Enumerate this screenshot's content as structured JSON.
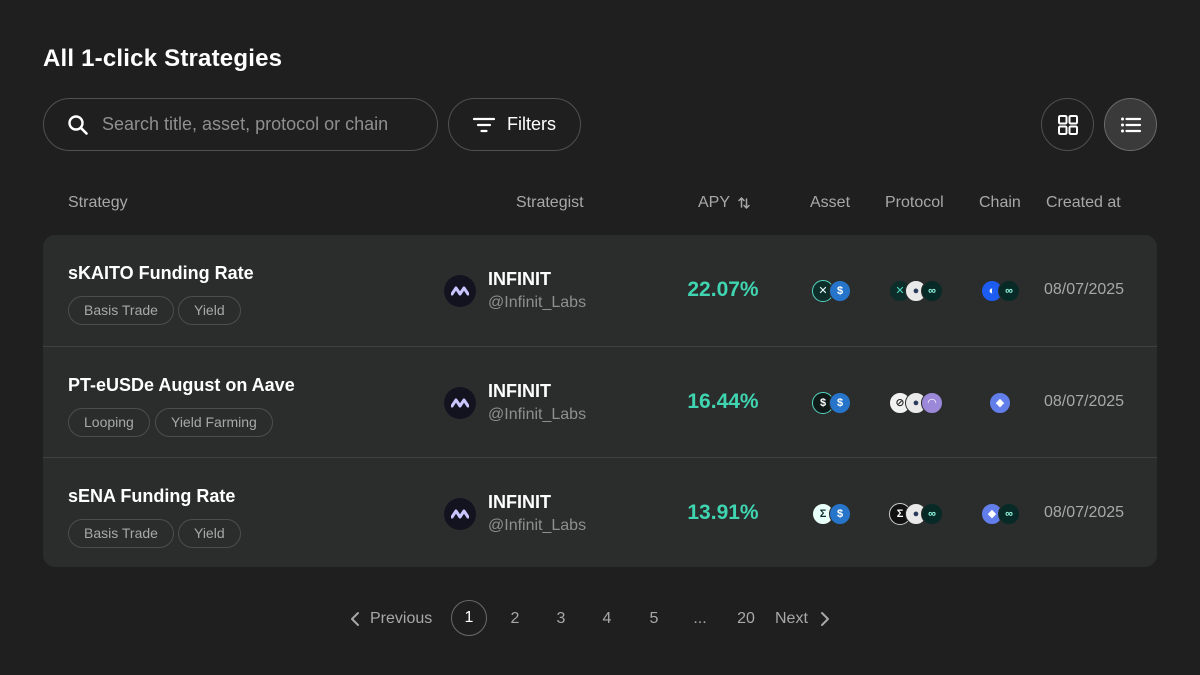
{
  "header": {
    "title": "All 1-click Strategies"
  },
  "search": {
    "placeholder": "Search title, asset, protocol or chain",
    "value": ""
  },
  "filters": {
    "label": "Filters"
  },
  "view_toggle": {
    "options": [
      "grid",
      "list"
    ],
    "selected": "list"
  },
  "table": {
    "columns": [
      "Strategy",
      "Strategist",
      "APY",
      "Asset",
      "Protocol",
      "Chain",
      "Created at"
    ],
    "rows": [
      {
        "name": "sKAITO Funding Rate",
        "tags": [
          "Basis Trade",
          "Yield"
        ],
        "strategist": {
          "name": "INFINIT",
          "handle": "@Infinit_Labs"
        },
        "apy": "22.07%",
        "assets": [
          "x-token-icon",
          "usdc-icon"
        ],
        "protocols": [
          "x-token-icon",
          "avatar-icon",
          "hyperliquid-icon"
        ],
        "chains": [
          "ens-chain-icon",
          "hyperliquid-icon"
        ],
        "created_at": "08/07/2025"
      },
      {
        "name": "PT-eUSDe August on Aave",
        "tags": [
          "Looping",
          "Yield Farming"
        ],
        "strategist": {
          "name": "INFINIT",
          "handle": "@Infinit_Labs"
        },
        "apy": "16.44%",
        "assets": [
          "eusde-icon",
          "usdc-icon"
        ],
        "protocols": [
          "pendle-icon",
          "avatar-icon",
          "aave-icon"
        ],
        "chains": [
          "ethereum-icon"
        ],
        "created_at": "08/07/2025"
      },
      {
        "name": "sENA Funding Rate",
        "tags": [
          "Basis Trade",
          "Yield"
        ],
        "strategist": {
          "name": "INFINIT",
          "handle": "@Infinit_Labs"
        },
        "apy": "13.91%",
        "assets": [
          "sena-icon",
          "usdc-icon"
        ],
        "protocols": [
          "ethena-icon",
          "avatar-icon",
          "hyperliquid-icon"
        ],
        "chains": [
          "ethereum-icon",
          "hyperliquid-icon"
        ],
        "created_at": "08/07/2025"
      }
    ]
  },
  "pagination": {
    "previous_label": "Previous",
    "pages": [
      "1",
      "2",
      "3",
      "4",
      "5",
      "...",
      "20"
    ],
    "current": "1",
    "next_label": "Next"
  },
  "colors": {
    "accent": "#3fd5b1",
    "background": "#1f1f1f",
    "card": "#2b2c2c"
  }
}
